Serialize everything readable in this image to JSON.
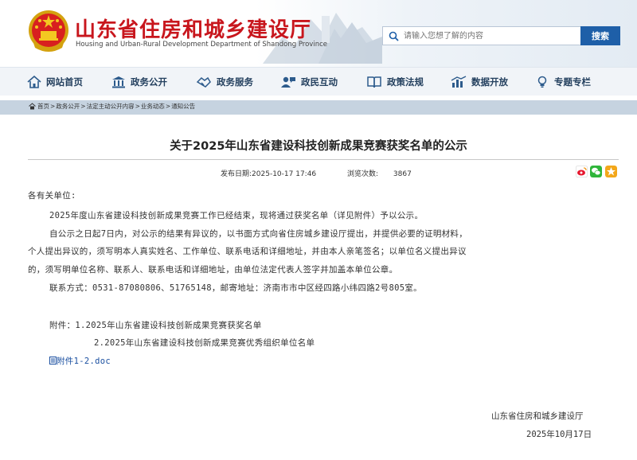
{
  "header": {
    "title": "山东省住房和城乡建设厅",
    "subtitle": "Housing and Urban-Rural Development Department of Shandong Province",
    "search_placeholder": "请输入您想了解的内容",
    "search_button": "搜索"
  },
  "nav": {
    "items": [
      {
        "label": "网站首页",
        "icon": "home-icon"
      },
      {
        "label": "政务公开",
        "icon": "building-icon"
      },
      {
        "label": "政务服务",
        "icon": "handshake-icon"
      },
      {
        "label": "政民互动",
        "icon": "user-chat-icon"
      },
      {
        "label": "政策法规",
        "icon": "book-icon"
      },
      {
        "label": "数据开放",
        "icon": "chart-icon"
      },
      {
        "label": "专题专栏",
        "icon": "bulb-icon"
      }
    ]
  },
  "breadcrumb": [
    "首页",
    "政务公开",
    "法定主动公开内容",
    "业务动态",
    "通知公告"
  ],
  "article": {
    "title": "关于2025年山东省建设科技创新成果竞赛获奖名单的公示",
    "publish_label": "发布日期:",
    "publish_date": "2025-10-17 17:46",
    "views_label": "浏览次数:",
    "views": "3867",
    "salutation": "各有关单位:",
    "para1": "2025年度山东省建设科技创新成果竞赛工作已经结束，现将通过获奖名单（详见附件）予以公示。",
    "para2_line1": "自公示之日起7日内，对公示的结果有异议的，以书面方式向省住房城乡建设厅提出，并提供必要的证明材料，",
    "para2_line2": "个人提出异议的，须写明本人真实姓名、工作单位、联系电话和详细地址，并由本人亲笔签名；以单位名义提出异议",
    "para2_line3": "的，须写明单位名称、联系人、联系电话和详细地址，由单位法定代表人签字并加盖本单位公章。",
    "contact": "联系方式：0531-87080806、51765148，邮寄地址：济南市市中区经四路小纬四路2号805室。",
    "attachments_label": "附件：",
    "attachment1": "1.2025年山东省建设科技创新成果竞赛获奖名单",
    "attachment2": "2.2025年山东省建设科技创新成果竞赛优秀组织单位名单",
    "file_link": "附件1-2.doc",
    "signature_org": "山东省住房和城乡建设厅",
    "signature_date": "2025年10月17日"
  },
  "colors": {
    "brand_red": "#c8161d",
    "search_blue": "#1e5fa8",
    "nav_text": "#24405f",
    "crumb_bar": "#c6d3e0",
    "link_blue": "#1a4fa0"
  }
}
